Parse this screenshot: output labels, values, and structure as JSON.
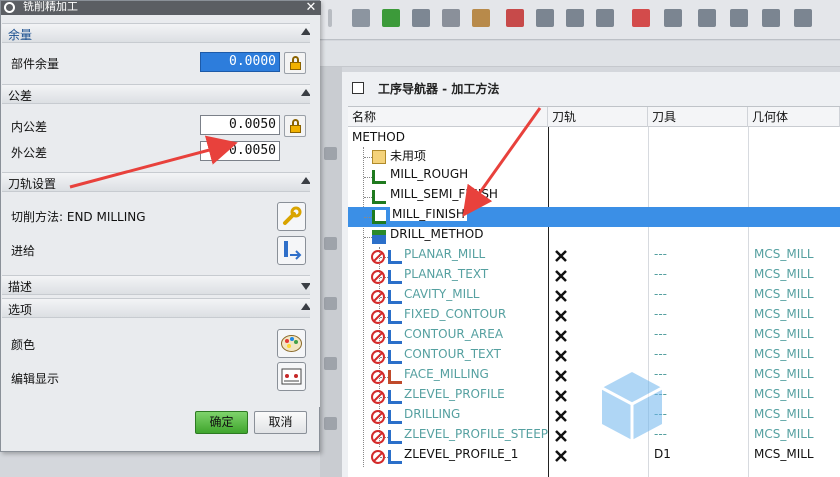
{
  "dialog": {
    "title": "铣削精加工",
    "sections": {
      "stock": "余量",
      "tolerance": "公差",
      "path_settings": "刀轨设置",
      "description": "描述",
      "options": "选项"
    },
    "part_stock_label": "部件余量",
    "part_stock_value": "0.0000",
    "intol_label": "内公差",
    "intol_value": "0.0050",
    "outtol_label": "外公差",
    "outtol_value": "0.0050",
    "cut_method_label": "切削方法: END MILLING",
    "feeds_label": "进给",
    "color_label": "颜色",
    "edit_display_label": "编辑显示",
    "ok_label": "确定",
    "cancel_label": "取消"
  },
  "navigator": {
    "title": "工序导航器 - 加工方法",
    "columns": [
      "名称",
      "刀轨",
      "刀具",
      "几何体"
    ],
    "root": "METHOD",
    "groups": [
      "未用项",
      "MILL_ROUGH",
      "MILL_SEMI_FINISH",
      "MILL_FINISH",
      "DRILL_METHOD"
    ],
    "operations": [
      {
        "name": "PLANAR_MILL",
        "tool": "---",
        "geometry": "MCS_MILL"
      },
      {
        "name": "PLANAR_TEXT",
        "tool": "---",
        "geometry": "MCS_MILL"
      },
      {
        "name": "CAVITY_MILL",
        "tool": "---",
        "geometry": "MCS_MILL"
      },
      {
        "name": "FIXED_CONTOUR",
        "tool": "---",
        "geometry": "MCS_MILL"
      },
      {
        "name": "CONTOUR_AREA",
        "tool": "---",
        "geometry": "MCS_MILL"
      },
      {
        "name": "CONTOUR_TEXT",
        "tool": "---",
        "geometry": "MCS_MILL"
      },
      {
        "name": "FACE_MILLING",
        "tool": "---",
        "geometry": "MCS_MILL"
      },
      {
        "name": "ZLEVEL_PROFILE",
        "tool": "---",
        "geometry": "MCS_MILL"
      },
      {
        "name": "DRILLING",
        "tool": "---",
        "geometry": "MCS_MILL"
      },
      {
        "name": "ZLEVEL_PROFILE_STEEP",
        "tool": "---",
        "geometry": "MCS_MILL"
      },
      {
        "name": "ZLEVEL_PROFILE_1",
        "tool": "D1",
        "geometry": "MCS_MILL"
      }
    ]
  },
  "colors": {
    "selection": "#3b8fe6",
    "annotation_arrow": "#e8413c",
    "ok_button": "#4caf3a",
    "inactive_text": "#55a0a0"
  }
}
